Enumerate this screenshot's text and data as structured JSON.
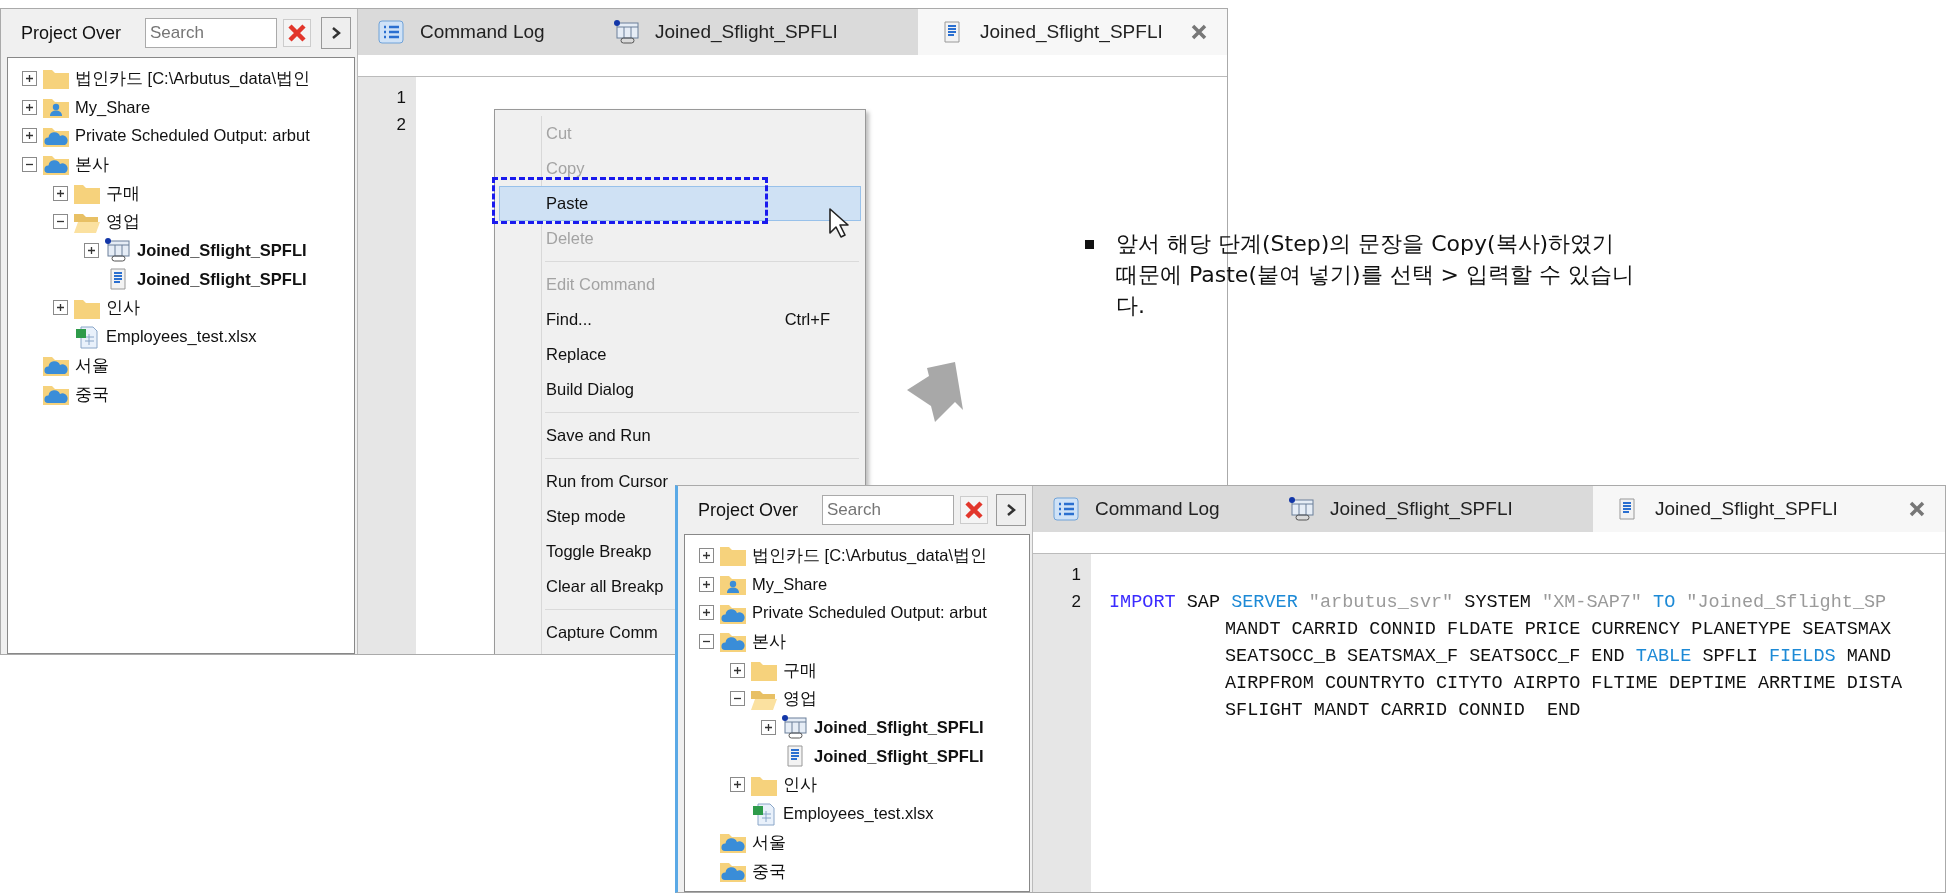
{
  "screenshots": [
    {
      "panel": {
        "title": "Project Over",
        "search": {
          "placeholder": "Search"
        }
      },
      "tree": [
        {
          "label": "법인카드 [C:\\Arbutus_data\\법인",
          "kind": "folder",
          "expanded": false
        },
        {
          "label": "My_Share",
          "kind": "person-folder",
          "expanded": false
        },
        {
          "label": "Private Scheduled Output:  arbut",
          "kind": "cloud-folder",
          "expanded": false
        },
        {
          "label": "본사",
          "kind": "cloud-folder",
          "expanded": true,
          "children": [
            {
              "label": "구매",
              "kind": "folder",
              "expanded": false
            },
            {
              "label": "영업",
              "kind": "open-folder",
              "expanded": true,
              "children": [
                {
                  "label": "Joined_Sflight_SPFLI",
                  "kind": "table",
                  "expanded": false,
                  "emphasized": true
                },
                {
                  "label": "Joined_Sflight_SPFLI",
                  "kind": "document",
                  "emphasized": true
                }
              ]
            },
            {
              "label": "인사",
              "kind": "folder",
              "expanded": false
            },
            {
              "label": "Employees_test.xlsx",
              "kind": "spreadsheet"
            }
          ]
        },
        {
          "label": "서울",
          "kind": "cloud-folder"
        },
        {
          "label": "중국",
          "kind": "cloud-folder"
        }
      ],
      "tabs": [
        {
          "label": "Command Log",
          "kind": "list",
          "selected": false
        },
        {
          "label": "Joined_Sflight_SPFLI",
          "kind": "table",
          "selected": false
        },
        {
          "label": "Joined_Sflight_SPFLI",
          "kind": "document",
          "selected": true
        }
      ],
      "editor": {
        "lines": [
          {
            "number": "1"
          },
          {
            "number": "2"
          }
        ]
      },
      "context_menu": {
        "items": [
          {
            "kind": "item",
            "label": "Cut",
            "disabled": true,
            "selected": false
          },
          {
            "kind": "item",
            "label": "Copy",
            "disabled": true,
            "selected": false
          },
          {
            "kind": "item",
            "label": "Paste",
            "disabled": false,
            "selected": true,
            "annotated": true
          },
          {
            "kind": "item",
            "label": "Delete",
            "disabled": true,
            "selected": false
          },
          {
            "kind": "separator"
          },
          {
            "kind": "item",
            "label": "Edit Command",
            "disabled": true,
            "selected": false
          },
          {
            "kind": "item",
            "label": "Find...",
            "shortcut": "Ctrl+F",
            "disabled": false,
            "selected": false
          },
          {
            "kind": "item",
            "label": "Replace",
            "disabled": false,
            "selected": false
          },
          {
            "kind": "item",
            "label": "Build Dialog",
            "disabled": false,
            "selected": false
          },
          {
            "kind": "separator"
          },
          {
            "kind": "item",
            "label": "Save and Run",
            "disabled": false,
            "selected": false
          },
          {
            "kind": "separator"
          },
          {
            "kind": "item",
            "label": "Run from Cursor",
            "disabled": false,
            "selected": false
          },
          {
            "kind": "item",
            "label": "Step mode",
            "disabled": false,
            "selected": false
          },
          {
            "kind": "item",
            "label": "Toggle Breakp",
            "disabled": false,
            "selected": false
          },
          {
            "kind": "item",
            "label": "Clear all Breakp",
            "disabled": false,
            "selected": false
          },
          {
            "kind": "separator"
          },
          {
            "kind": "item",
            "label": "Capture Comm",
            "disabled": false,
            "selected": false
          }
        ]
      }
    },
    {
      "panel": {
        "title": "Project Over",
        "search": {
          "placeholder": "Search"
        }
      },
      "tree": [
        {
          "label": "법인카드 [C:\\Arbutus_data\\법인",
          "kind": "folder",
          "expanded": false
        },
        {
          "label": "My_Share",
          "kind": "person-folder",
          "expanded": false
        },
        {
          "label": "Private Scheduled Output:  arbut",
          "kind": "cloud-folder",
          "expanded": false
        },
        {
          "label": "본사",
          "kind": "cloud-folder",
          "expanded": true,
          "children": [
            {
              "label": "구매",
              "kind": "folder",
              "expanded": false
            },
            {
              "label": "영업",
              "kind": "open-folder",
              "expanded": true,
              "children": [
                {
                  "label": "Joined_Sflight_SPFLI",
                  "kind": "table",
                  "expanded": false,
                  "emphasized": true
                },
                {
                  "label": "Joined_Sflight_SPFLI",
                  "kind": "document",
                  "emphasized": true
                }
              ]
            },
            {
              "label": "인사",
              "kind": "folder",
              "expanded": false
            },
            {
              "label": "Employees_test.xlsx",
              "kind": "spreadsheet"
            }
          ]
        },
        {
          "label": "서울",
          "kind": "cloud-folder"
        },
        {
          "label": "중국",
          "kind": "cloud-folder"
        }
      ],
      "tabs": [
        {
          "label": "Command Log",
          "kind": "list",
          "selected": false
        },
        {
          "label": "Joined_Sflight_SPFLI",
          "kind": "table",
          "selected": false
        },
        {
          "label": "Joined_Sflight_SPFLI",
          "kind": "document",
          "selected": true
        }
      ],
      "editor": {
        "lines": [
          {
            "number": "1"
          },
          {
            "number": "2",
            "rows": [
              {
                "tokens": [
                  {
                    "text": "IMPORT",
                    "kind": "keyword"
                  },
                  {
                    "text": " SAP ",
                    "kind": "plain"
                  },
                  {
                    "text": "SERVER",
                    "kind": "keyword2"
                  },
                  {
                    "text": " \"arbutus_svr\"",
                    "kind": "string"
                  },
                  {
                    "text": " SYSTEM ",
                    "kind": "plain"
                  },
                  {
                    "text": "\"XM-SAP7\"",
                    "kind": "string"
                  },
                  {
                    "text": " TO",
                    "kind": "keyword2"
                  },
                  {
                    "text": " \"Joined_Sflight_SP",
                    "kind": "string"
                  }
                ]
              },
              {
                "tokens": [
                  {
                    "text": "MANDT CARRID CONNID FLDATE PRICE CURRENCY PLANETYPE SEATSMAX",
                    "kind": "plain"
                  }
                ]
              },
              {
                "tokens": [
                  {
                    "text": "SEATSOCC_B SEATSMAX_F SEATSOCC_F END ",
                    "kind": "plain"
                  },
                  {
                    "text": "TABLE",
                    "kind": "keyword2"
                  },
                  {
                    "text": " SPFLI ",
                    "kind": "plain"
                  },
                  {
                    "text": "FIELDS",
                    "kind": "keyword2"
                  },
                  {
                    "text": " MAND",
                    "kind": "plain"
                  }
                ]
              },
              {
                "tokens": [
                  {
                    "text": "AIRPFROM COUNTRYTO CITYTO AIRPTO FLTIME DEPTIME ARRTIME DISTA",
                    "kind": "plain"
                  }
                ]
              },
              {
                "tokens": [
                  {
                    "text": "SFLIGHT MANDT CARRID CONNID  END",
                    "kind": "plain"
                  }
                ]
              }
            ]
          }
        ]
      }
    }
  ],
  "note": {
    "text": "앞서 해당 단계(Step)의 문장을 Copy(복사)하였기 때문에 Paste(붙여 넣기)를 선택 > 입력할 수 있습니다."
  }
}
